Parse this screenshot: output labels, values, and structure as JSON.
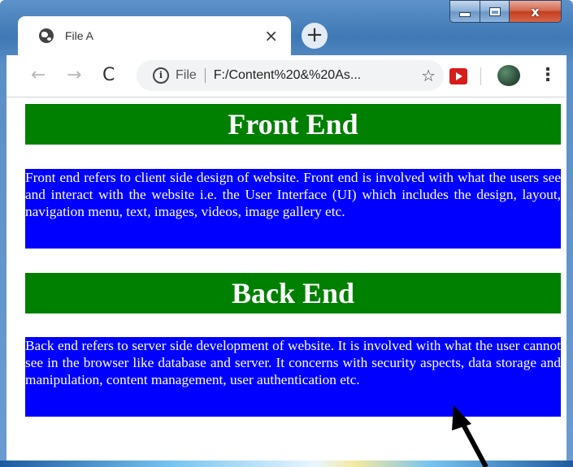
{
  "browser": {
    "tab": {
      "title": "File A",
      "close_glyph": "×",
      "icon": "globe-icon"
    },
    "new_tab_glyph": "+",
    "window_controls": {
      "close_glyph": "x"
    },
    "toolbar": {
      "back_glyph": "←",
      "forward_glyph": "→",
      "reload_glyph": "C",
      "info_glyph": "i",
      "scheme_label": "File",
      "url": "F:/Content%20&%20As...",
      "star_glyph": "☆",
      "menu_glyph": "⋮"
    }
  },
  "page": {
    "sections": [
      {
        "heading": "Front End",
        "text": "Front end refers to client side design of website. Front end is involved with what the users see and interact with the website i.e. the User Interface (UI) which includes the design, layout, navigation menu, text, images, videos, image gallery etc."
      },
      {
        "heading": "Back End",
        "text": "Back end refers to server side development of website. It is involved with what the user cannot see in the browser like database and server. It concerns with security aspects, data storage and manipulation, content management, user authentication etc."
      }
    ],
    "colors": {
      "heading_bg": "#008000",
      "paragraph_bg": "#0000ff",
      "text": "#ffffff"
    }
  }
}
